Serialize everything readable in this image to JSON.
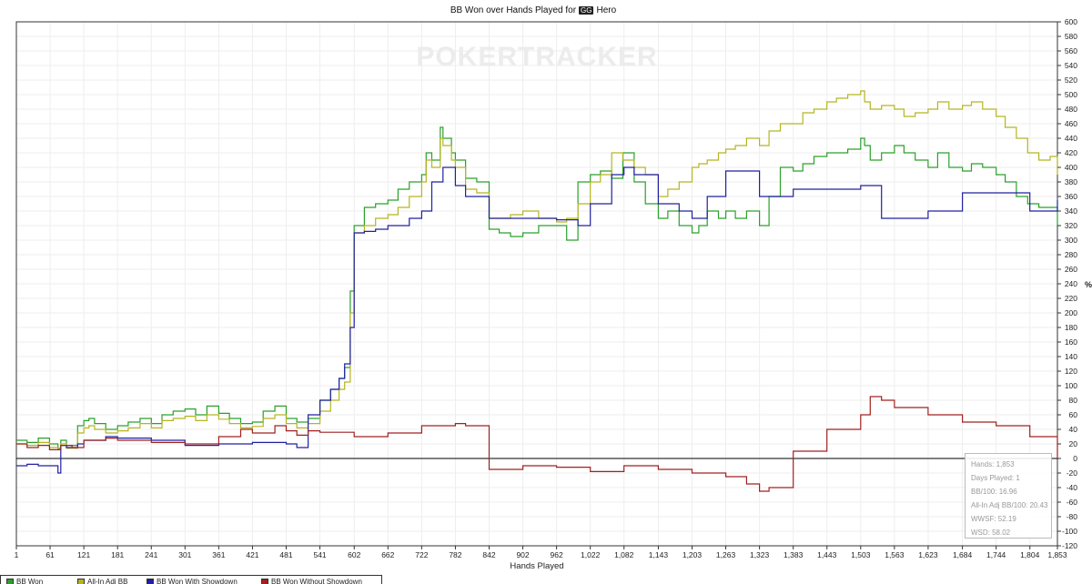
{
  "chart_data": {
    "type": "line",
    "title_prefix": "BB Won over Hands Played for",
    "title_tag": "GG",
    "title_player": "Hero",
    "watermark": "POKERTRACKER",
    "xlabel": "Hands Played",
    "ylabel": "%",
    "xlim": [
      1,
      1853
    ],
    "ylim": [
      -120,
      600
    ],
    "x_ticks": [
      "1",
      "61",
      "121",
      "181",
      "241",
      "301",
      "361",
      "421",
      "481",
      "541",
      "602",
      "662",
      "722",
      "782",
      "842",
      "902",
      "962",
      "1,022",
      "1,082",
      "1,143",
      "1,203",
      "1,263",
      "1,323",
      "1,383",
      "1,443",
      "1,503",
      "1,563",
      "1,623",
      "1,684",
      "1,744",
      "1,804",
      "1,853"
    ],
    "y_ticks": [
      600,
      580,
      560,
      540,
      520,
      500,
      480,
      460,
      440,
      420,
      400,
      380,
      360,
      340,
      320,
      300,
      280,
      260,
      240,
      220,
      200,
      180,
      160,
      140,
      120,
      100,
      80,
      60,
      40,
      20,
      0,
      -20,
      -40,
      -60,
      -80,
      -100,
      -120
    ],
    "grid": true,
    "series": [
      {
        "name": "BB Won",
        "color": "#2aa02a",
        "x": [
          1,
          20,
          40,
          60,
          75,
          80,
          90,
          110,
          121,
          130,
          140,
          160,
          181,
          200,
          221,
          241,
          260,
          280,
          301,
          320,
          340,
          361,
          380,
          400,
          421,
          440,
          461,
          481,
          500,
          520,
          541,
          560,
          575,
          585,
          595,
          602,
          620,
          640,
          662,
          680,
          700,
          722,
          730,
          740,
          755,
          760,
          775,
          782,
          800,
          820,
          842,
          860,
          880,
          902,
          930,
          962,
          980,
          1000,
          1022,
          1040,
          1060,
          1080,
          1100,
          1120,
          1143,
          1160,
          1180,
          1203,
          1215,
          1230,
          1250,
          1263,
          1280,
          1300,
          1323,
          1340,
          1360,
          1383,
          1400,
          1420,
          1443,
          1460,
          1480,
          1503,
          1510,
          1520,
          1540,
          1563,
          1580,
          1600,
          1623,
          1640,
          1660,
          1684,
          1700,
          1720,
          1744,
          1760,
          1780,
          1800,
          1820,
          1840,
          1853
        ],
        "values": [
          25,
          22,
          28,
          20,
          14,
          25,
          18,
          45,
          52,
          55,
          48,
          40,
          45,
          50,
          55,
          48,
          60,
          65,
          68,
          60,
          72,
          62,
          55,
          48,
          50,
          65,
          72,
          55,
          50,
          55,
          80,
          95,
          110,
          125,
          230,
          320,
          345,
          350,
          355,
          370,
          380,
          390,
          420,
          410,
          455,
          440,
          420,
          410,
          385,
          380,
          315,
          310,
          305,
          310,
          320,
          320,
          300,
          380,
          390,
          395,
          385,
          420,
          380,
          350,
          330,
          340,
          320,
          310,
          320,
          340,
          330,
          340,
          330,
          340,
          320,
          360,
          400,
          395,
          405,
          415,
          420,
          420,
          425,
          440,
          430,
          410,
          420,
          430,
          420,
          410,
          400,
          420,
          400,
          395,
          405,
          400,
          390,
          380,
          360,
          350,
          345,
          345,
          320
        ]
      },
      {
        "name": "All-In Adj BB",
        "color": "#b5b520",
        "x": [
          1,
          20,
          40,
          60,
          75,
          80,
          90,
          110,
          121,
          130,
          140,
          160,
          181,
          200,
          221,
          241,
          260,
          280,
          301,
          320,
          340,
          361,
          380,
          400,
          421,
          440,
          461,
          481,
          500,
          520,
          541,
          560,
          575,
          585,
          595,
          602,
          620,
          640,
          662,
          680,
          700,
          722,
          730,
          740,
          755,
          760,
          775,
          782,
          800,
          820,
          842,
          860,
          880,
          902,
          930,
          962,
          980,
          1000,
          1022,
          1040,
          1060,
          1080,
          1100,
          1120,
          1143,
          1160,
          1180,
          1203,
          1215,
          1230,
          1250,
          1263,
          1280,
          1300,
          1323,
          1340,
          1360,
          1383,
          1400,
          1420,
          1443,
          1460,
          1480,
          1503,
          1510,
          1520,
          1540,
          1563,
          1580,
          1600,
          1623,
          1640,
          1660,
          1684,
          1700,
          1720,
          1744,
          1760,
          1780,
          1800,
          1820,
          1840,
          1853
        ],
        "values": [
          20,
          18,
          22,
          15,
          12,
          20,
          14,
          35,
          42,
          45,
          40,
          35,
          38,
          42,
          48,
          42,
          52,
          55,
          58,
          52,
          60,
          54,
          48,
          42,
          44,
          55,
          60,
          48,
          42,
          48,
          65,
          80,
          95,
          105,
          200,
          310,
          320,
          330,
          335,
          345,
          360,
          380,
          410,
          400,
          440,
          430,
          410,
          400,
          370,
          365,
          330,
          330,
          335,
          340,
          330,
          325,
          330,
          350,
          380,
          390,
          420,
          410,
          400,
          390,
          360,
          370,
          380,
          400,
          405,
          410,
          420,
          425,
          430,
          440,
          430,
          450,
          460,
          460,
          475,
          480,
          490,
          495,
          500,
          505,
          490,
          480,
          485,
          480,
          470,
          475,
          480,
          490,
          480,
          485,
          490,
          480,
          470,
          455,
          440,
          420,
          410,
          415,
          390
        ]
      },
      {
        "name": "BB Won With Showdown",
        "color": "#2020a0",
        "x": [
          1,
          20,
          40,
          60,
          75,
          80,
          90,
          110,
          121,
          160,
          181,
          241,
          301,
          361,
          421,
          481,
          500,
          520,
          541,
          560,
          575,
          585,
          595,
          602,
          620,
          640,
          662,
          700,
          722,
          740,
          760,
          782,
          800,
          842,
          902,
          962,
          1000,
          1022,
          1060,
          1082,
          1100,
          1143,
          1180,
          1203,
          1230,
          1263,
          1323,
          1383,
          1443,
          1503,
          1540,
          1563,
          1623,
          1684,
          1744,
          1804,
          1853
        ],
        "values": [
          -10,
          -8,
          -10,
          -10,
          -20,
          18,
          15,
          20,
          25,
          30,
          28,
          25,
          18,
          20,
          22,
          20,
          15,
          60,
          80,
          95,
          110,
          130,
          180,
          310,
          312,
          315,
          320,
          330,
          340,
          380,
          400,
          375,
          360,
          330,
          330,
          328,
          320,
          350,
          390,
          400,
          390,
          350,
          340,
          330,
          360,
          395,
          360,
          370,
          370,
          375,
          330,
          330,
          340,
          365,
          365,
          340,
          355
        ]
      },
      {
        "name": "BB Won Without Showdown",
        "color": "#a02020",
        "x": [
          1,
          20,
          40,
          60,
          80,
          100,
          121,
          160,
          181,
          241,
          301,
          361,
          400,
          421,
          461,
          481,
          500,
          520,
          541,
          602,
          662,
          722,
          782,
          800,
          842,
          902,
          962,
          1022,
          1082,
          1143,
          1203,
          1263,
          1300,
          1323,
          1340,
          1383,
          1443,
          1503,
          1520,
          1540,
          1563,
          1623,
          1684,
          1744,
          1804,
          1853
        ],
        "values": [
          20,
          15,
          18,
          12,
          18,
          15,
          25,
          28,
          25,
          22,
          20,
          30,
          40,
          35,
          45,
          38,
          32,
          38,
          36,
          30,
          35,
          45,
          48,
          45,
          -15,
          -10,
          -12,
          -18,
          -10,
          -15,
          -20,
          -25,
          -35,
          -45,
          -40,
          10,
          40,
          60,
          85,
          80,
          70,
          60,
          50,
          45,
          30,
          0
        ]
      }
    ],
    "stats": [
      "Hands: 1,853",
      "Days Played: 1",
      "BB/100: 16.96",
      "All-In Adj BB/100: 20.43",
      "WWSF: 52.19",
      "WSD: 58.02"
    ]
  },
  "colors": {
    "axis": "#333333",
    "grid": "#eeeeee",
    "zero_line": "#000000"
  }
}
